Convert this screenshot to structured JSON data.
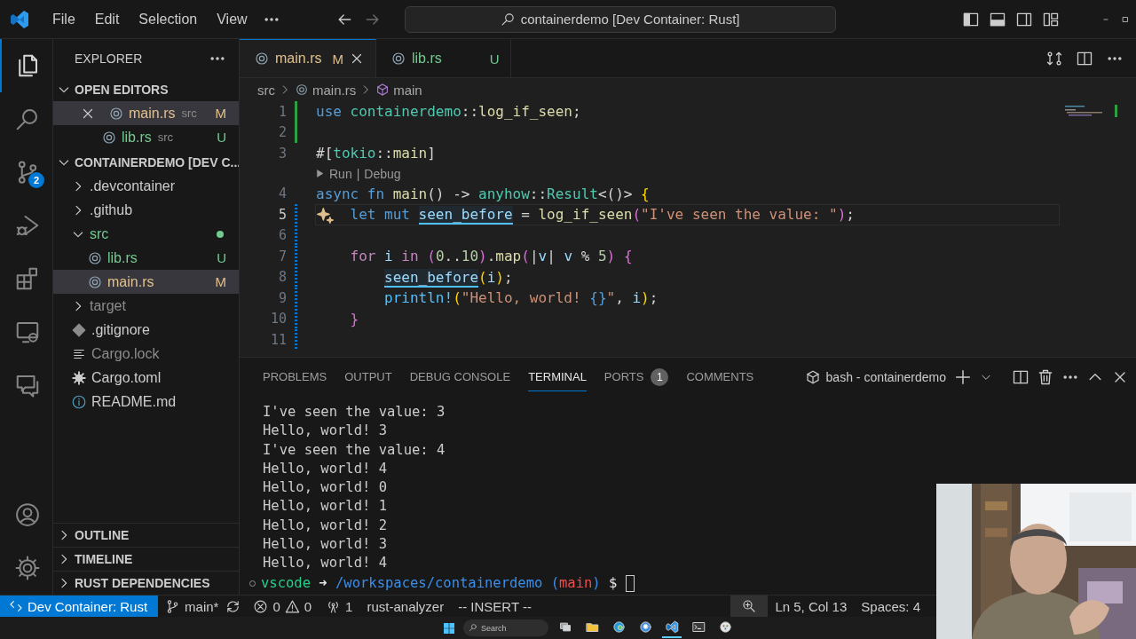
{
  "title_bar": {
    "menu": [
      "File",
      "Edit",
      "Selection",
      "View"
    ],
    "command_center": "containerdemo [Dev Container: Rust]"
  },
  "activity_bar": {
    "items": [
      {
        "kind": "files",
        "selected": true
      },
      {
        "kind": "search",
        "selected": false
      },
      {
        "kind": "source-control",
        "selected": false,
        "badge": "2"
      },
      {
        "kind": "run-debug",
        "selected": false
      },
      {
        "kind": "extensions",
        "selected": false
      },
      {
        "kind": "remote",
        "selected": false
      },
      {
        "kind": "comments",
        "selected": false
      }
    ],
    "bottom": [
      {
        "kind": "account"
      },
      {
        "kind": "settings"
      }
    ]
  },
  "sidebar": {
    "title": "EXPLORER",
    "open_editors": {
      "title": "OPEN EDITORS",
      "expanded": true,
      "items": [
        {
          "name": "main.rs",
          "folder": "src",
          "status": "M",
          "color": "#e2c08d",
          "kind": "rust",
          "selected": true
        },
        {
          "name": "lib.rs",
          "folder": "src",
          "status": "U",
          "color": "#73c991",
          "kind": "rust",
          "selected": false
        }
      ]
    },
    "tree": {
      "title": "CONTAINERDEMO [DEV C...",
      "expanded": true,
      "items": [
        {
          "name": ".devcontainer",
          "kind": "folder",
          "expanded": false,
          "status_dot": false,
          "selected": false
        },
        {
          "name": ".github",
          "kind": "folder",
          "expanded": false,
          "status_dot": false,
          "selected": false
        },
        {
          "name": "src",
          "kind": "folder",
          "expanded": true,
          "color": "#73c991",
          "status_dot": true,
          "selected": false,
          "children": [
            {
              "name": "lib.rs",
              "kind": "rust",
              "color": "#73c991",
              "status": "U",
              "selected": false
            },
            {
              "name": "main.rs",
              "kind": "rust",
              "color": "#e2c08d",
              "status": "M",
              "selected": true
            }
          ]
        },
        {
          "name": "target",
          "kind": "folder",
          "expanded": false,
          "color": "#8c8c8c",
          "status_dot": false,
          "selected": false
        },
        {
          "name": ".gitignore",
          "kind": "git",
          "selected": false
        },
        {
          "name": "Cargo.lock",
          "kind": "lines",
          "color": "#8c8c8c",
          "selected": false
        },
        {
          "name": "Cargo.toml",
          "kind": "gear",
          "selected": false
        },
        {
          "name": "README.md",
          "kind": "info",
          "selected": false
        }
      ]
    },
    "sections": [
      {
        "title": "OUTLINE",
        "expanded": false
      },
      {
        "title": "TIMELINE",
        "expanded": false
      },
      {
        "title": "RUST DEPENDENCIES",
        "expanded": false
      }
    ]
  },
  "editor": {
    "tabs": [
      {
        "name": "main.rs",
        "status": "M",
        "color": "#e2c08d",
        "selected": true
      },
      {
        "name": "lib.rs",
        "status": "U",
        "color": "#73c991",
        "selected": false
      }
    ],
    "breadcrumbs": [
      {
        "text": "src",
        "kind": "folder"
      },
      {
        "text": "main.rs",
        "kind": "rust"
      },
      {
        "text": "main",
        "kind": "symbol"
      }
    ],
    "lines": [
      {
        "kind": "code",
        "number": "1",
        "added": true,
        "modified": false,
        "current": false,
        "tokens": [
          {
            "kind": "kw",
            "text": "use "
          },
          {
            "kind": "type",
            "text": "containerdemo"
          },
          {
            "kind": "plain",
            "text": "::"
          },
          {
            "kind": "fn",
            "text": "log_if_seen"
          },
          {
            "kind": "plain",
            "text": ";"
          }
        ]
      },
      {
        "kind": "code",
        "number": "2",
        "added": true,
        "modified": false,
        "current": false
      },
      {
        "kind": "code",
        "number": "3",
        "added": false,
        "modified": false,
        "current": false,
        "tokens": [
          {
            "kind": "plain",
            "text": "#["
          },
          {
            "kind": "type",
            "text": "tokio"
          },
          {
            "kind": "plain",
            "text": "::"
          },
          {
            "kind": "fn",
            "text": "main"
          },
          {
            "kind": "plain",
            "text": "]"
          }
        ]
      },
      {
        "kind": "codelens",
        "links": [
          "Run",
          "Debug"
        ],
        "separator": "|"
      },
      {
        "kind": "code",
        "number": "4",
        "added": false,
        "modified": false,
        "current": false,
        "tokens": [
          {
            "kind": "kw",
            "text": "async fn "
          },
          {
            "kind": "fn",
            "text": "main"
          },
          {
            "kind": "plain",
            "text": "() -> "
          },
          {
            "kind": "type",
            "text": "anyhow"
          },
          {
            "kind": "plain",
            "text": "::"
          },
          {
            "kind": "type",
            "text": "Result"
          },
          {
            "kind": "plain",
            "text": "<()> "
          },
          {
            "kind": "bracket",
            "text": "{"
          }
        ]
      },
      {
        "kind": "code",
        "number": "5",
        "added": false,
        "modified": true,
        "current": true,
        "tokens": [
          {
            "kind": "kw",
            "text": "    let mut "
          },
          {
            "kind": "var-hl",
            "text": "seen_before"
          },
          {
            "kind": "plain",
            "text": " = "
          },
          {
            "kind": "fn",
            "text": "log_if_seen"
          },
          {
            "kind": "bracket2",
            "text": "("
          },
          {
            "kind": "str",
            "text": "\"I've seen the value: \""
          },
          {
            "kind": "bracket2",
            "text": ")"
          },
          {
            "kind": "plain",
            "text": ";"
          }
        ]
      },
      {
        "kind": "code",
        "number": "6",
        "added": false,
        "modified": true,
        "current": false
      },
      {
        "kind": "code",
        "number": "7",
        "added": false,
        "modified": true,
        "current": false,
        "tokens": [
          {
            "kind": "ctl",
            "text": "    for "
          },
          {
            "kind": "var",
            "text": "i "
          },
          {
            "kind": "ctl",
            "text": "in "
          },
          {
            "kind": "bracket2",
            "text": "("
          },
          {
            "kind": "num",
            "text": "0"
          },
          {
            "kind": "plain",
            "text": ".."
          },
          {
            "kind": "num",
            "text": "10"
          },
          {
            "kind": "bracket2",
            "text": ")"
          },
          {
            "kind": "plain",
            "text": "."
          },
          {
            "kind": "fn",
            "text": "map"
          },
          {
            "kind": "bracket2",
            "text": "("
          },
          {
            "kind": "plain",
            "text": "|"
          },
          {
            "kind": "var",
            "text": "v"
          },
          {
            "kind": "plain",
            "text": "| "
          },
          {
            "kind": "var",
            "text": "v"
          },
          {
            "kind": "plain",
            "text": " % "
          },
          {
            "kind": "num",
            "text": "5"
          },
          {
            "kind": "bracket2",
            "text": ")"
          },
          {
            "kind": "bracket2",
            "text": " {"
          }
        ]
      },
      {
        "kind": "code",
        "number": "8",
        "added": false,
        "modified": true,
        "current": false,
        "tokens": [
          {
            "kind": "var-hl",
            "text": "        seen_before"
          },
          {
            "kind": "bracket",
            "text": "("
          },
          {
            "kind": "var",
            "text": "i"
          },
          {
            "kind": "bracket",
            "text": ")"
          },
          {
            "kind": "plain",
            "text": ";"
          }
        ]
      },
      {
        "kind": "code",
        "number": "9",
        "added": false,
        "modified": true,
        "current": false,
        "tokens": [
          {
            "kind": "macro",
            "text": "        println!"
          },
          {
            "kind": "bracket",
            "text": "("
          },
          {
            "kind": "str",
            "text": "\"Hello, world! "
          },
          {
            "kind": "kw",
            "text": "{}"
          },
          {
            "kind": "str",
            "text": "\""
          },
          {
            "kind": "plain",
            "text": ", "
          },
          {
            "kind": "var",
            "text": "i"
          },
          {
            "kind": "bracket",
            "text": ")"
          },
          {
            "kind": "plain",
            "text": ";"
          }
        ]
      },
      {
        "kind": "code",
        "number": "10",
        "added": false,
        "modified": true,
        "current": false,
        "tokens": [
          {
            "kind": "bracket2",
            "text": "    }"
          }
        ]
      },
      {
        "kind": "code",
        "number": "11",
        "added": false,
        "modified": true,
        "current": false
      }
    ]
  },
  "panel": {
    "tabs": [
      {
        "label": "PROBLEMS",
        "selected": false
      },
      {
        "label": "OUTPUT",
        "selected": false
      },
      {
        "label": "DEBUG CONSOLE",
        "selected": false
      },
      {
        "label": "TERMINAL",
        "selected": true
      },
      {
        "label": "PORTS",
        "selected": false,
        "badge": "1"
      },
      {
        "label": "COMMENTS",
        "selected": false
      }
    ],
    "terminal_name": "bash - containerdemo",
    "output": [
      "I've seen the value: 3",
      "Hello, world! 3",
      "I've seen the value: 4",
      "Hello, world! 4",
      "Hello, world! 0",
      "Hello, world! 1",
      "Hello, world! 2",
      "Hello, world! 3",
      "Hello, world! 4"
    ],
    "prompt": [
      {
        "kind": "user",
        "text": "vscode "
      },
      {
        "kind": "plain",
        "text": "➜ "
      },
      {
        "kind": "path",
        "text": "/workspaces/containerdemo"
      },
      {
        "kind": "paren",
        "text": " ("
      },
      {
        "kind": "branch",
        "text": "main"
      },
      {
        "kind": "paren",
        "text": ")"
      },
      {
        "kind": "plain",
        "text": " $ "
      }
    ]
  },
  "status_bar": {
    "remote": "Dev Container: Rust",
    "branch": "main*",
    "errors": "0",
    "warnings": "0",
    "ports": "1",
    "language_server": "rust-analyzer",
    "mode": "-- INSERT --",
    "position": "Ln 5, Col 13",
    "indentation": "Spaces: 4"
  },
  "taskbar": {
    "search": {
      "placeholder": "Search"
    },
    "apps": [
      {
        "kind": "task-view",
        "selected": false
      },
      {
        "kind": "folder",
        "selected": false
      },
      {
        "kind": "browser",
        "selected": false
      },
      {
        "kind": "chat",
        "selected": false
      },
      {
        "kind": "editor",
        "selected": true
      },
      {
        "kind": "terminal",
        "selected": false
      },
      {
        "kind": "paint",
        "selected": false
      }
    ]
  }
}
